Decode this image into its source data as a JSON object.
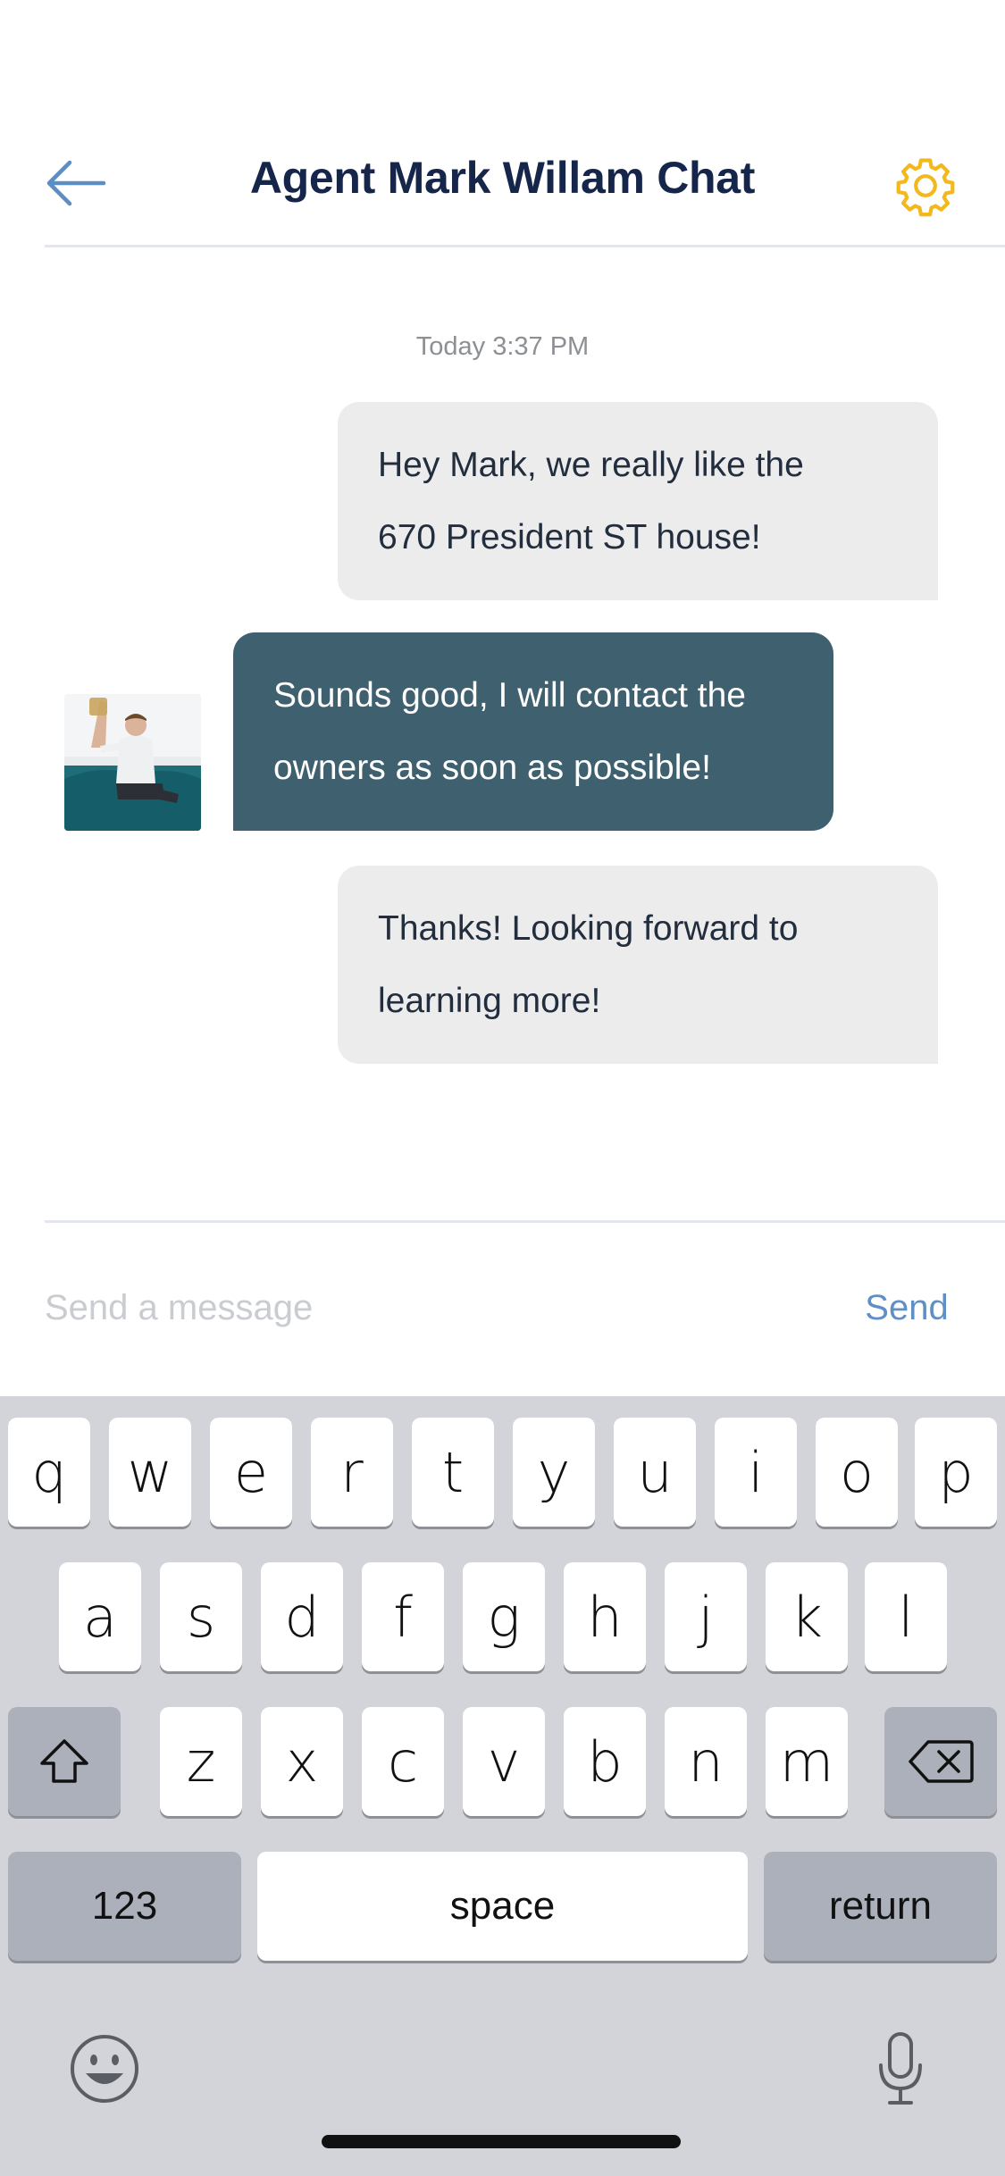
{
  "header": {
    "title": "Agent Mark Willam Chat",
    "back_icon": "arrow-left-icon",
    "settings_icon": "gear-icon",
    "accent_color": "#f2b81c",
    "back_color": "#5b8ec4"
  },
  "chat": {
    "timestamp": "Today 3:37 PM",
    "messages": [
      {
        "from": "me",
        "lines": [
          "Hey Mark, we really like the",
          "670 President ST house!"
        ]
      },
      {
        "from": "agent",
        "lines": [
          "Sounds good, I will contact the",
          "owners as soon as possible!"
        ]
      },
      {
        "from": "me",
        "lines": [
          "Thanks! Looking forward to",
          "learning more!"
        ]
      }
    ]
  },
  "composer": {
    "placeholder": "Send a message",
    "send_label": "Send"
  },
  "keyboard": {
    "row1": [
      "q",
      "w",
      "e",
      "r",
      "t",
      "y",
      "u",
      "i",
      "o",
      "p"
    ],
    "row2": [
      "a",
      "s",
      "d",
      "f",
      "g",
      "h",
      "j",
      "k",
      "l"
    ],
    "row3": [
      "z",
      "x",
      "c",
      "v",
      "b",
      "n",
      "m"
    ],
    "numbers_label": "123",
    "space_label": "space",
    "return_label": "return",
    "shift_icon": "shift-icon",
    "delete_icon": "backspace-icon",
    "emoji_icon": "emoji-icon",
    "mic_icon": "microphone-icon"
  }
}
